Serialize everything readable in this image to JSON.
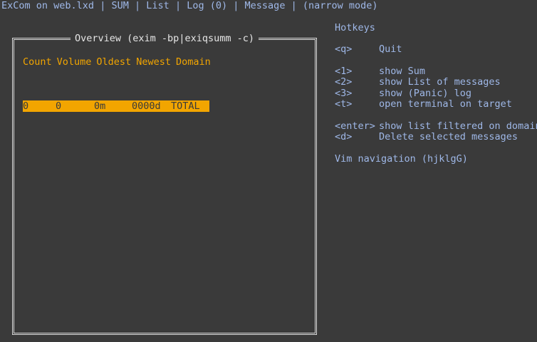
{
  "app_title": "ExCom on web.lxd",
  "menu": {
    "sep": "|",
    "items": [
      "SUM",
      "List",
      "Log (0)",
      "Message",
      "(narrow mode)"
    ]
  },
  "overview": {
    "title": "Overview (exim -bp|exiqsumm -c)",
    "columns": [
      "Count",
      "Volume",
      "Oldest",
      "Newest",
      "Domain"
    ],
    "rows": [
      {
        "count": "0",
        "volume": "0",
        "oldest": "0m",
        "newest": "0000d",
        "domain": "TOTAL"
      }
    ]
  },
  "hotkeys": {
    "title": "Hotkeys",
    "quit": {
      "key": "<q>",
      "desc": "Quit"
    },
    "group1": [
      {
        "key": "<1>",
        "desc": "show Sum"
      },
      {
        "key": "<2>",
        "desc": "show List of messages"
      },
      {
        "key": "<3>",
        "desc": "show (Panic) log"
      },
      {
        "key": "<t>",
        "desc": "open terminal on target"
      }
    ],
    "group2": [
      {
        "key": "<enter>",
        "desc": "show list filtered on domain"
      },
      {
        "key": "<d>",
        "desc": "Delete selected messages"
      }
    ],
    "vim": "Vim navigation (hjklgG)"
  },
  "colors": {
    "background": "#3a3a3a",
    "text": "#9fb8e8",
    "accent": "#f2a500",
    "border": "#d8d8d8"
  }
}
